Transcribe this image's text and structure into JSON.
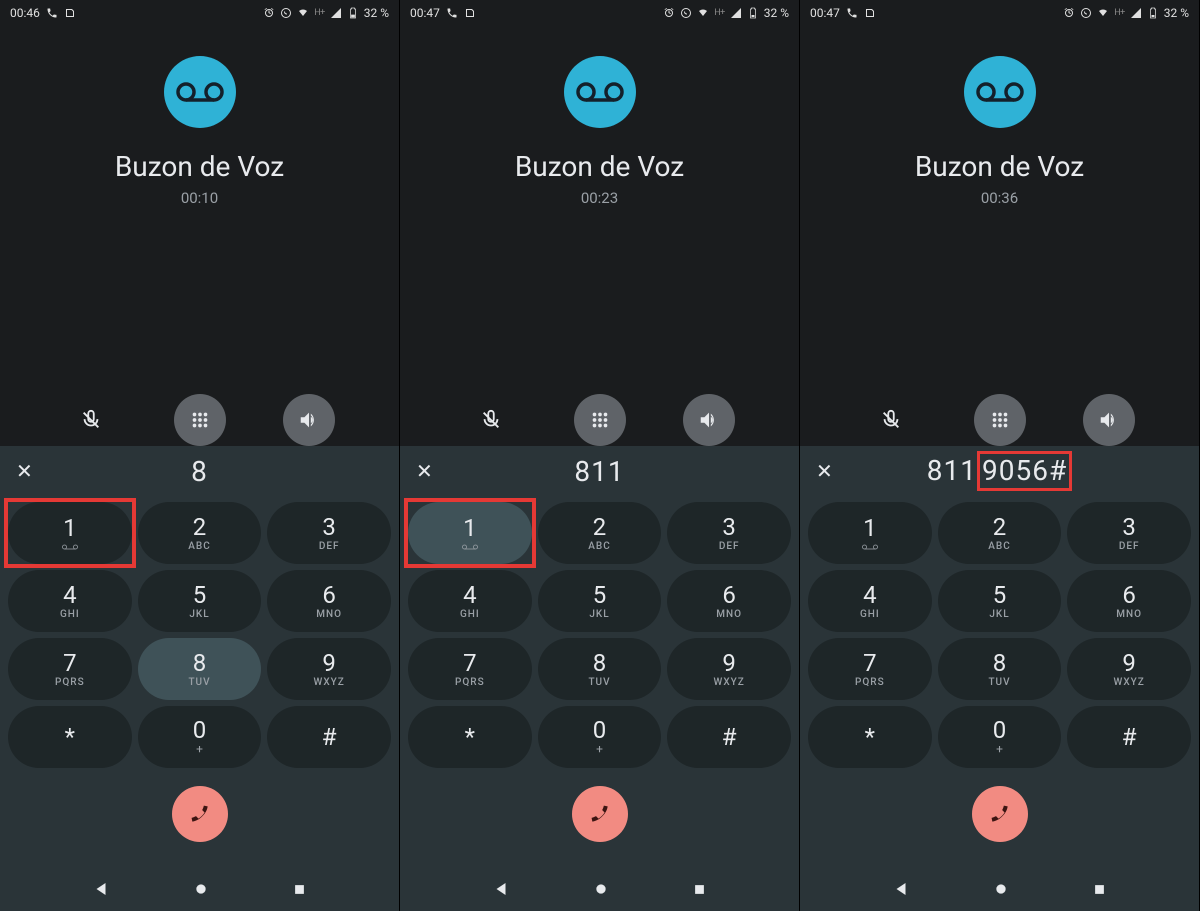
{
  "screens": [
    {
      "status": {
        "time": "00:46",
        "battery": "32 %",
        "net": "H+"
      },
      "contact": "Buzon de Voz",
      "duration": "00:10",
      "dialed": "8",
      "dialed_highlight": null,
      "pressed_key_index": 7,
      "red_box_key_index": 0
    },
    {
      "status": {
        "time": "00:47",
        "battery": "32 %",
        "net": "H+"
      },
      "contact": "Buzon de Voz",
      "duration": "00:23",
      "dialed": "811",
      "dialed_highlight": null,
      "pressed_key_index": 0,
      "red_box_key_index": 0
    },
    {
      "status": {
        "time": "00:47",
        "battery": "32 %",
        "net": "H+"
      },
      "contact": "Buzon de Voz",
      "duration": "00:36",
      "dialed_prefix": "811",
      "dialed_highlight": "9056#",
      "pressed_key_index": null,
      "red_box_key_index": null
    }
  ],
  "keys": [
    {
      "digit": "1",
      "sub": "vm"
    },
    {
      "digit": "2",
      "sub": "ABC"
    },
    {
      "digit": "3",
      "sub": "DEF"
    },
    {
      "digit": "4",
      "sub": "GHI"
    },
    {
      "digit": "5",
      "sub": "JKL"
    },
    {
      "digit": "6",
      "sub": "MNO"
    },
    {
      "digit": "7",
      "sub": "PQRS"
    },
    {
      "digit": "8",
      "sub": "TUV"
    },
    {
      "digit": "9",
      "sub": "WXYZ"
    },
    {
      "digit": "*",
      "sub": ""
    },
    {
      "digit": "0",
      "sub": "+"
    },
    {
      "digit": "#",
      "sub": ""
    }
  ],
  "colors": {
    "avatar_bg": "#2fb2d6",
    "hangup_bg": "#f28b82",
    "highlight_red": "#e53935"
  }
}
